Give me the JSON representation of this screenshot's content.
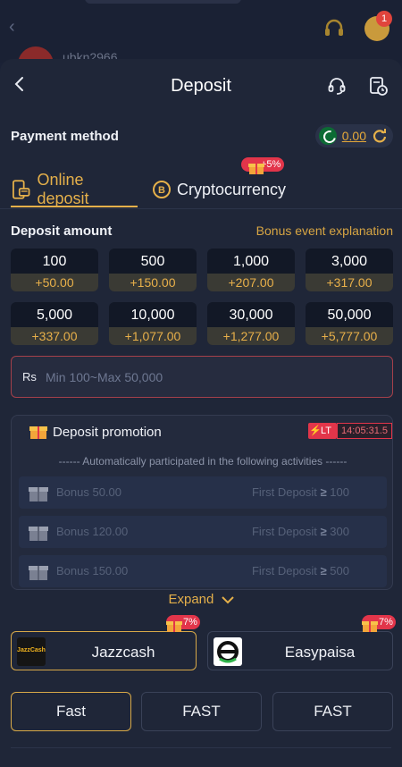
{
  "background": {
    "username": "ubkn2966",
    "notification_count": "1"
  },
  "header": {
    "title": "Deposit"
  },
  "payment_method": {
    "label": "Payment method",
    "balance": "0.00"
  },
  "tabs": [
    {
      "label": "Online deposit"
    },
    {
      "label": "Cryptocurrency",
      "badge": "+5%"
    }
  ],
  "deposit_amount": {
    "label": "Deposit amount",
    "bonus_link": "Bonus event explanation",
    "options": [
      {
        "value": "100",
        "bonus": "+50.00"
      },
      {
        "value": "500",
        "bonus": "+150.00"
      },
      {
        "value": "1,000",
        "bonus": "+207.00"
      },
      {
        "value": "3,000",
        "bonus": "+317.00"
      },
      {
        "value": "5,000",
        "bonus": "+337.00"
      },
      {
        "value": "10,000",
        "bonus": "+1,077.00"
      },
      {
        "value": "30,000",
        "bonus": "+1,277.00"
      },
      {
        "value": "50,000",
        "bonus": "+5,777.00"
      }
    ]
  },
  "amount_input": {
    "currency": "Rs",
    "placeholder": "Min 100~Max 50,000"
  },
  "promotion": {
    "title": "Deposit promotion",
    "lt_label": "LT",
    "timer": "14:05:31.5",
    "subtitle": "------ Automatically participated in the following activities ------",
    "items": [
      {
        "bonus": "Bonus 50.00",
        "condition": "First Deposit",
        "threshold": "100"
      },
      {
        "bonus": "Bonus 120.00",
        "condition": "First Deposit",
        "threshold": "300"
      },
      {
        "bonus": "Bonus 150.00",
        "condition": "First Deposit",
        "threshold": "500"
      }
    ]
  },
  "expand_label": "Expand",
  "providers": [
    {
      "name": "Jazzcash",
      "badge": "7%",
      "logo_text": "JazzCash"
    },
    {
      "name": "Easypaisa",
      "badge": "7%"
    }
  ],
  "channels": [
    {
      "label": "Fast"
    },
    {
      "label": "FAST"
    },
    {
      "label": "FAST"
    }
  ],
  "colors": {
    "accent": "#e5b04a",
    "badge_red": "#e2354a",
    "background": "#1f2638"
  }
}
